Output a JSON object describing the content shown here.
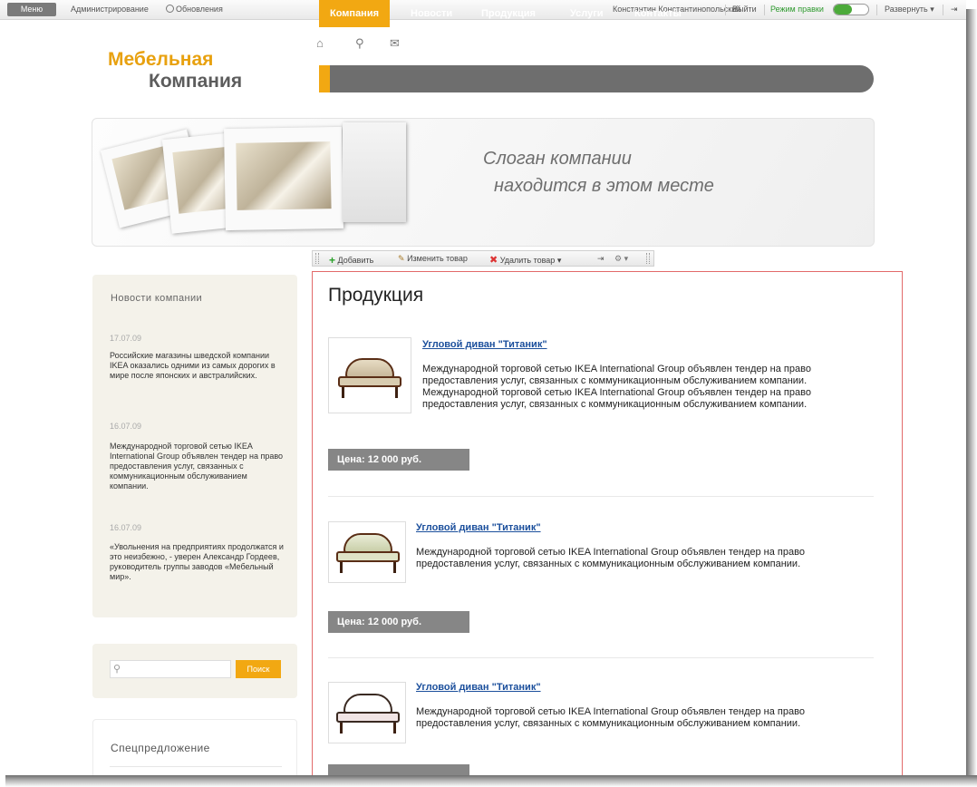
{
  "adminbar": {
    "menu": "Меню",
    "admin": "Администрирование",
    "updates": "Обновления",
    "user": "Константин Константинопольский",
    "exit": "Выйти",
    "edit_mode": "Режим правки",
    "toggle_on": true,
    "expand": "Развернуть",
    "expand_arrow": "▾",
    "pin_icon": "pin-icon"
  },
  "header": {
    "logo_line1": "Мебельная",
    "logo_line2": "Компания",
    "icons": [
      "home-icon",
      "search-icon",
      "mail-icon"
    ]
  },
  "nav": [
    {
      "label": "Компания",
      "active": true
    },
    {
      "label": "Новости",
      "active": false
    },
    {
      "label": "Продукция",
      "active": false
    },
    {
      "label": "Услуги",
      "active": false
    },
    {
      "label": "Контакты",
      "active": false
    }
  ],
  "banner": {
    "slogan_line1": "Слоган компании",
    "slogan_line2": "находится в этом месте"
  },
  "toolbar": {
    "add": "Добавить",
    "edit": "Изменить товар",
    "delete": "Удалить товар",
    "dropdown_arrow": "▾"
  },
  "sidebar": {
    "news_title": "Новости компании",
    "news": [
      {
        "date": "17.07.09",
        "text": "Российские магазины шведской компании IKEA оказались одними из самых дорогих в мире после японских и австралийских."
      },
      {
        "date": "16.07.09",
        "text": "Международной торговой сетью IKEA International Group объявлен тендер на право предоставления услуг, связанных с коммуникационным обслуживанием компании."
      },
      {
        "date": "16.07.09",
        "text": "«Увольнения на предприятиях продолжатся и это неизбежно, - уверен Александр Гордеев, руководитель группы заводов «Мебельный мир»."
      }
    ],
    "search_placeholder": "",
    "search_button": "Поиск",
    "special_title": "Спецпредложение"
  },
  "content": {
    "title": "Продукция",
    "products": [
      {
        "name": "Угловой диван \"Титаник\"",
        "desc": "Международной торговой сетью IKEA International Group объявлен тендер на право предоставления услуг, связанных с коммуникационным обслуживанием компании. Международной торговой сетью IKEA International Group объявлен тендер на право предоставления услуг, связанных с коммуникационным обслуживанием компании.",
        "price": "Цена: 12 000 руб."
      },
      {
        "name": "Угловой диван \"Титаник\"",
        "desc": "Международной торговой сетью IKEA International Group объявлен тендер на право предоставления услуг, связанных с коммуникационным обслуживанием компании.",
        "price": "Цена: 12 000 руб."
      },
      {
        "name": "Угловой диван \"Титаник\"",
        "desc": "Международной торговой сетью IKEA International Group объявлен тендер на право предоставления услуг, связанных с коммуникационным обслуживанием компании.",
        "price": ""
      }
    ]
  },
  "colors": {
    "accent": "#f2a812",
    "nav_bg": "#6e6e6e",
    "link": "#1b4f9c",
    "price_bg": "#868686",
    "edit_frame": "#e26a6a"
  }
}
